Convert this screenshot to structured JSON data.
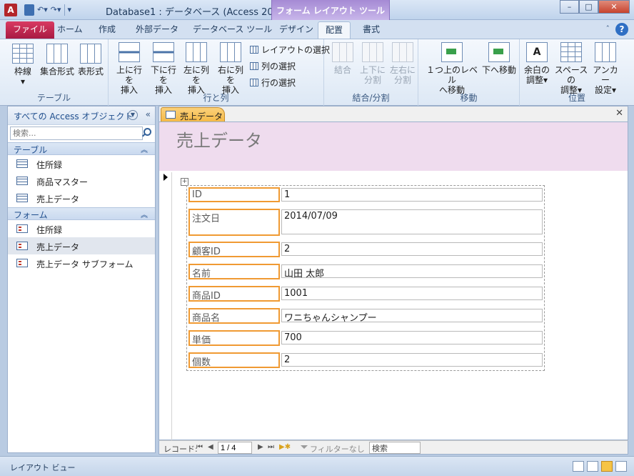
{
  "titlebar": {
    "app_icon_letter": "A",
    "title": "Database1 : データベース (Access 200...",
    "context_tab_group": "フォーム レイアウト ツール",
    "minimize": "–",
    "maximize": "□",
    "close": "✕"
  },
  "tabs": {
    "file": "ファイル",
    "home": "ホーム",
    "create": "作成",
    "external": "外部データ",
    "dbtools": "データベース ツール",
    "design": "デザイン",
    "arrange": "配置",
    "format": "書式",
    "help": "?",
    "minimize_ribbon": "ˆ"
  },
  "ribbon": {
    "table_group": {
      "label": "テーブル",
      "gridlines": "枠線",
      "stacked": "集合形式",
      "tabular": "表形式"
    },
    "rows_cols_group": {
      "label": "行と列",
      "insert_above": [
        "上に行を",
        "挿入"
      ],
      "insert_below": [
        "下に行を",
        "挿入"
      ],
      "insert_left": [
        "左に列を",
        "挿入"
      ],
      "insert_right": [
        "右に列を",
        "挿入"
      ],
      "select_layout": "レイアウトの選択",
      "select_column": "列の選択",
      "select_row": "行の選択"
    },
    "merge_group": {
      "label": "結合/分割",
      "merge": "結合",
      "split_vert": [
        "上下に",
        "分割"
      ],
      "split_horz": [
        "左右に",
        "分割"
      ]
    },
    "move_group": {
      "label": "移動",
      "move_up": [
        "１つ上のレベル",
        "へ移動"
      ],
      "move_down": "下へ移動"
    },
    "position_group": {
      "label": "位置",
      "margins": [
        "余白の",
        "調整"
      ],
      "padding": [
        "スペースの",
        "調整"
      ],
      "anchoring": [
        "アンカー",
        "設定"
      ]
    }
  },
  "nav": {
    "title": "すべての Access オブジェクト",
    "search_placeholder": "検索...",
    "groups": [
      {
        "label": "テーブル",
        "items": [
          "住所録",
          "商品マスター",
          "売上データ"
        ]
      },
      {
        "label": "フォーム",
        "items": [
          "住所録",
          "売上データ",
          "売上データ サブフォーム"
        ]
      }
    ],
    "selected_item": "売上データ"
  },
  "document": {
    "tab_label": "売上データ",
    "form_title": "売上データ",
    "fields": [
      {
        "label": "ID",
        "value": "1"
      },
      {
        "label": "注文日",
        "value": "2014/07/09"
      },
      {
        "label": "顧客ID",
        "value": "2"
      },
      {
        "label": "名前",
        "value": "山田 太郎"
      },
      {
        "label": "商品ID",
        "value": "1001"
      },
      {
        "label": "商品名",
        "value": "ワニちゃんシャンプー"
      },
      {
        "label": "単価",
        "value": "700"
      },
      {
        "label": "個数",
        "value": "2"
      }
    ]
  },
  "record_nav": {
    "label": "レコード:",
    "position": "1 / 4",
    "filter": "フィルターなし",
    "search": "検索"
  },
  "status": {
    "view_name": "レイアウト ビュー"
  },
  "colors": {
    "file_tab": "#c2255c",
    "context_tab": "#b59ee0",
    "form_header": "#efdcee",
    "label_border": "#f09a33",
    "doc_tab": "#f4b845"
  }
}
